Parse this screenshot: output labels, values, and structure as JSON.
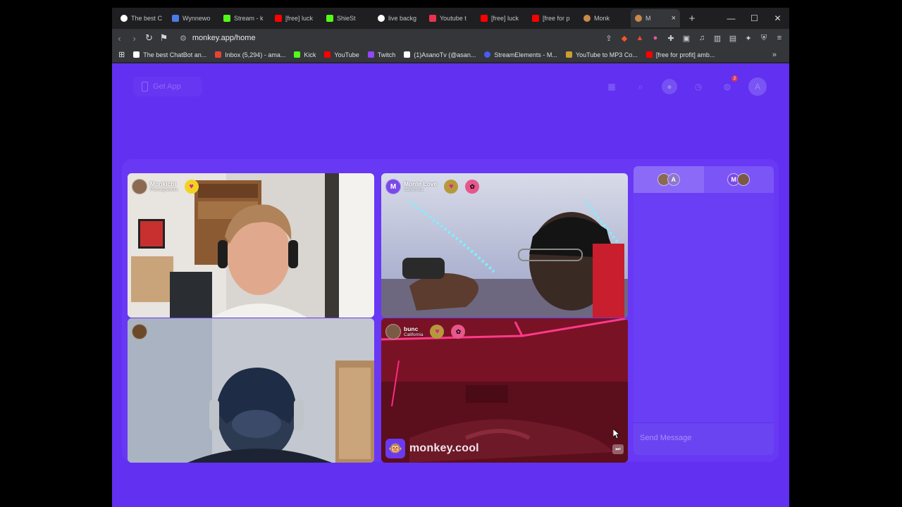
{
  "browser": {
    "tabs": [
      {
        "label": "The best C",
        "color": "#ffffff"
      },
      {
        "label": "Wynnewo",
        "color": "#4c7ae8"
      },
      {
        "label": "Stream - k",
        "color": "#53fc18"
      },
      {
        "label": "[free] luck",
        "color": "#ff0000"
      },
      {
        "label": "ShieSt",
        "color": "#53fc18"
      },
      {
        "label": "live backg",
        "color": "#ffffff"
      },
      {
        "label": "Youtube t",
        "color": "#e8334f"
      },
      {
        "label": "[free] luck",
        "color": "#ff0000"
      },
      {
        "label": "[free for p",
        "color": "#ff0000"
      },
      {
        "label": "Monk",
        "color": "#c78a4a"
      },
      {
        "label": "M",
        "color": "#c78a4a"
      }
    ],
    "url": "monkey.app/home",
    "bookmarks": [
      {
        "label": "The best ChatBot an...",
        "color": "#ffffff"
      },
      {
        "label": "Inbox (5,294) - ama...",
        "color": "#ea4335"
      },
      {
        "label": "Kick",
        "color": "#53fc18"
      },
      {
        "label": "YouTube",
        "color": "#ff0000"
      },
      {
        "label": "Twitch",
        "color": "#9146ff"
      },
      {
        "label": "(1)AsanoTv (@asan...",
        "color": "#ffffff"
      },
      {
        "label": "StreamElements - M...",
        "color": "#4a5cf0"
      },
      {
        "label": "YouTube to MP3 Co...",
        "color": "#c9a030"
      },
      {
        "label": "[free for profit] amb...",
        "color": "#ff0000"
      }
    ]
  },
  "app": {
    "get_app": "Get App",
    "notification_count": "2",
    "profile_initial": "A",
    "tiles": [
      {
        "name": "Monkichi",
        "location": "Pennsylvania"
      },
      {
        "name": "Monte Love",
        "location": "California",
        "initial": "M"
      },
      {
        "name": "",
        "location": ""
      },
      {
        "name": "bunc",
        "location": "California"
      }
    ],
    "brand": "monkey.cool",
    "chat": {
      "tab1_initial": "A",
      "tab2_initial": "M",
      "send_placeholder": "Send Message"
    }
  }
}
